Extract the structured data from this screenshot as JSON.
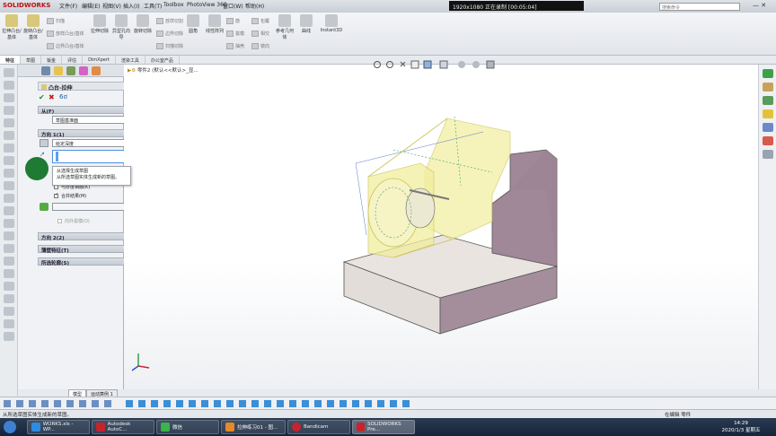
{
  "app": {
    "name": "SOLIDWORKS"
  },
  "menu": [
    "文件(F)",
    "编辑(E)",
    "视图(V)",
    "插入(I)",
    "工具(T)",
    "Toolbox",
    "PhotoView 360",
    "窗口(W)",
    "帮助(H)"
  ],
  "recorder": {
    "text": "1920x1080  正在录制 [00:05:04]"
  },
  "search": {
    "placeholder": "搜索命令"
  },
  "ribbon": {
    "big": [
      "拉伸凸台/基体",
      "旋转凸台/基体",
      "扫描",
      "放样凸台/基体",
      "边界凸台/基体",
      "拉伸切除",
      "异型孔向导",
      "旋转切除",
      "放样切割",
      "边界切除",
      "扫描切除",
      "圆角",
      "线性阵列",
      "筋",
      "拔模",
      "抽壳",
      "包覆",
      "相交",
      "镜向",
      "参考几何体",
      "曲线",
      "Instant3D"
    ]
  },
  "tabs": [
    "特征",
    "草图",
    "钣金",
    "评估",
    "DimXpert",
    "渲染工具",
    "办公室产品"
  ],
  "breadcrumb": "零件2 (默认<<默认>_显...",
  "pm": {
    "title": "凸台-拉伸",
    "from_header": "从(F)",
    "from_value": "草图基准面",
    "dir1_header": "方向 1(1)",
    "dir1_value": "给定深度",
    "reverse_label": "与厚度相融(K)",
    "merge_label": "合并结果(M)",
    "draft_label": "向外拔模(O)",
    "dir2_header": "方向 2(2)",
    "thin_header": "薄壁特征(T)",
    "selected_header": "所选轮廓(S)"
  },
  "tooltip": {
    "title": "从选择生成草图",
    "body": "从所选草图实体生成新的草图。"
  },
  "bottom_tabs": [
    "模型",
    "运动算例 1"
  ],
  "status": {
    "left": "从所选草图实体生成新的草图。",
    "right": "在编辑 零件"
  },
  "taskbar": {
    "items": [
      "WORKS.xls - WP...",
      "Autodesk AutoC...",
      "微信",
      "拉伸练习01 - 图...",
      "Bandicam",
      "SOLIDWORKS Pre..."
    ],
    "time": "14:29",
    "date": "2020/1/3 星期五"
  },
  "colors": {
    "accent": "#b11",
    "preview": "#f2ee9e",
    "part_top": "#e7e2dd",
    "part_side": "#9e8a96"
  }
}
